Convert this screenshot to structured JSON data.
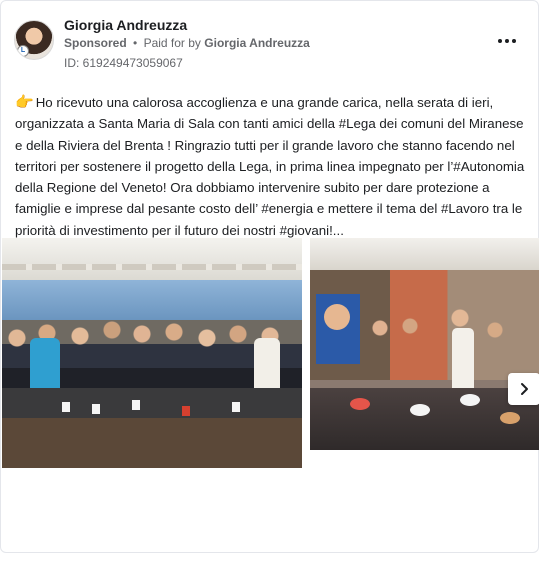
{
  "post": {
    "author_name": "Giorgia Andreuzza",
    "sponsored_label": "Sponsored",
    "separator": "•",
    "paid_for_prefix": "Paid for by",
    "paid_for_name": "Giorgia Andreuzza",
    "ad_id": "ID: 619249473059067",
    "pointing_icon": "👉",
    "text": "Ho ricevuto una calorosa accoglienza e una grande carica, nella serata di ieri, organizzata a Santa Maria di Sala con tanti amici della #Lega dei comuni del Miranese e della Riviera del Brenta ! Ringrazio tutti per il grande lavoro che stanno facendo nel territori per sostenere il progetto della Lega, in prima linea impegnato per l’#Autonomia della Regione del Veneto! Ora dobbiamo intervenire subito per dare protezione a famiglie e imprese dal pesante costo dell’ #energia e mettere il tema del #Lavoro tra le priorità di investimento per il futuro dei nostri #giovani!..."
  },
  "icons": {
    "more": "more-options-icon",
    "next": "chevron-right-icon",
    "avatar_badge": "party-badge-icon"
  },
  "colors": {
    "text": "#1c1e21",
    "secondary": "#65676b",
    "border": "#e4e6eb"
  }
}
